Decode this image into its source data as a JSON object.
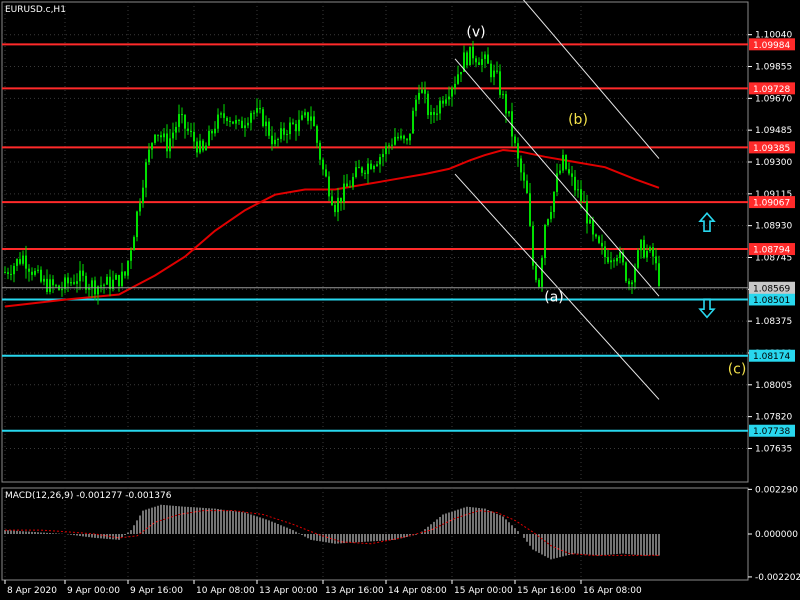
{
  "header": {
    "symbol": "EURUSD.c,H1",
    "macd_label": "MACD(12,26,9) -0.001277 -0.001376"
  },
  "colors": {
    "background": "#000000",
    "grid": "#3a3a3a",
    "candle": "#00e000",
    "ma": "#e00000",
    "resistance": "#ff2a2a",
    "support": "#28d7ee",
    "channel": "#e8e8e8",
    "macd_hist": "#e8e8e8",
    "macd_signal": "#e00000",
    "wave_white": "#ffffff",
    "wave_yellow": "#f3e14a",
    "arrow": "#28d7ee"
  },
  "chart_data": [
    {
      "type": "candlestick",
      "symbol": "EURUSD.c",
      "timeframe": "H1",
      "y_ticks": [
        "1.10040",
        "1.09855",
        "1.09670",
        "1.09485",
        "1.09300",
        "1.09115",
        "1.08930",
        "1.08745",
        "1.08560",
        "1.08375",
        "1.08190",
        "1.08005",
        "1.07820",
        "1.07635"
      ],
      "ylim": [
        1.0744,
        1.1023
      ],
      "x_ticks": [
        "8 Apr 2020",
        "9 Apr 00:00",
        "9 Apr 16:00",
        "10 Apr 08:00",
        "13 Apr 00:00",
        "13 Apr 16:00",
        "14 Apr 08:00",
        "15 Apr 00:00",
        "15 Apr 16:00",
        "16 Apr 08:00"
      ],
      "price_path": [
        [
          0,
          1.0866
        ],
        [
          6,
          1.0875
        ],
        [
          12,
          1.086
        ],
        [
          18,
          1.0856
        ],
        [
          24,
          1.0863
        ],
        [
          30,
          1.0858
        ],
        [
          36,
          1.086
        ],
        [
          40,
          1.0864
        ],
        [
          43,
          1.089
        ],
        [
          46,
          1.092
        ],
        [
          50,
          1.095
        ],
        [
          54,
          1.094
        ],
        [
          58,
          1.0955
        ],
        [
          62,
          1.0945
        ],
        [
          66,
          1.0935
        ],
        [
          70,
          1.0952
        ],
        [
          74,
          1.0958
        ],
        [
          78,
          1.095
        ],
        [
          82,
          1.096
        ],
        [
          86,
          1.0955
        ],
        [
          90,
          1.094
        ],
        [
          94,
          1.095
        ],
        [
          98,
          1.0952
        ],
        [
          102,
          1.0958
        ],
        [
          106,
          1.0925
        ],
        [
          110,
          1.0905
        ],
        [
          114,
          1.0915
        ],
        [
          118,
          1.0925
        ],
        [
          122,
          1.093
        ],
        [
          126,
          1.0935
        ],
        [
          130,
          1.0945
        ],
        [
          134,
          1.094
        ],
        [
          138,
          1.0975
        ],
        [
          142,
          1.0955
        ],
        [
          146,
          1.0968
        ],
        [
          150,
          1.0978
        ],
        [
          153,
          1.099
        ],
        [
          156,
          1.0993
        ],
        [
          160,
          1.0988
        ],
        [
          164,
          1.0978
        ],
        [
          168,
          1.0955
        ],
        [
          171,
          1.093
        ],
        [
          174,
          1.091
        ],
        [
          176,
          1.087
        ],
        [
          178,
          1.086
        ],
        [
          180,
          1.0895
        ],
        [
          182,
          1.0905
        ],
        [
          184,
          1.092
        ],
        [
          186,
          1.093
        ],
        [
          188,
          1.0922
        ],
        [
          190,
          1.0915
        ],
        [
          193,
          1.0905
        ],
        [
          196,
          1.0885
        ],
        [
          200,
          1.0875
        ],
        [
          204,
          1.0878
        ],
        [
          208,
          1.086
        ],
        [
          212,
          1.088
        ],
        [
          216,
          1.0875
        ],
        [
          218,
          1.0862
        ]
      ],
      "ma": [
        [
          0,
          1.0846
        ],
        [
          20,
          1.085
        ],
        [
          38,
          1.0853
        ],
        [
          50,
          1.0864
        ],
        [
          60,
          1.0875
        ],
        [
          70,
          1.089
        ],
        [
          80,
          1.0902
        ],
        [
          90,
          1.0911
        ],
        [
          100,
          1.0914
        ],
        [
          110,
          1.0914
        ],
        [
          120,
          1.0917
        ],
        [
          130,
          1.092
        ],
        [
          140,
          1.0923
        ],
        [
          148,
          1.0926
        ],
        [
          155,
          1.0931
        ],
        [
          160,
          1.0934
        ],
        [
          166,
          1.0937
        ],
        [
          172,
          1.0936
        ],
        [
          180,
          1.0933
        ],
        [
          190,
          1.093
        ],
        [
          200,
          1.0927
        ],
        [
          210,
          1.092
        ],
        [
          218,
          1.0915
        ]
      ],
      "levels": [
        {
          "label": "1.09984",
          "price": 1.09984,
          "kind": "resistance"
        },
        {
          "label": "1.09728",
          "price": 1.09728,
          "kind": "resistance"
        },
        {
          "label": "1.09385",
          "price": 1.09385,
          "kind": "resistance"
        },
        {
          "label": "1.09067",
          "price": 1.09067,
          "kind": "resistance"
        },
        {
          "label": "1.08794",
          "price": 1.08794,
          "kind": "resistance"
        },
        {
          "label": "1.08501",
          "price": 1.08501,
          "kind": "support"
        },
        {
          "label": "1.08174",
          "price": 1.08174,
          "kind": "support"
        },
        {
          "label": "1.07738",
          "price": 1.07738,
          "kind": "support"
        }
      ],
      "current_price": {
        "label": "1.08569",
        "price": 1.08569
      },
      "channel": [
        {
          "from": [
            150,
            1.099
          ],
          "to": [
            218,
            1.0852
          ]
        },
        {
          "from": [
            150,
            1.0923
          ],
          "to": [
            218,
            1.0792
          ]
        },
        {
          "from": [
            170,
            1.103
          ],
          "to": [
            218,
            1.0932
          ]
        }
      ],
      "wave_labels": [
        {
          "text": "(v)",
          "at": [
            157,
            1.1003
          ],
          "color": "wave_white"
        },
        {
          "text": "(b)",
          "at": [
            191,
            1.0952
          ],
          "color": "wave_yellow"
        },
        {
          "text": "(a)",
          "at": [
            183,
            1.0849
          ],
          "color": "wave_white"
        },
        {
          "text": "(c)",
          "at": [
            244,
            1.0807
          ],
          "color": "wave_yellow"
        }
      ],
      "arrows": [
        {
          "direction": "up",
          "at": [
            234,
            1.0895
          ]
        },
        {
          "direction": "down",
          "at": [
            234,
            1.0845
          ]
        }
      ],
      "bars_visible": 219
    },
    {
      "type": "macd",
      "title": "MACD(12,26,9) -0.001277 -0.001376",
      "params": [
        12,
        26,
        9
      ],
      "y_ticks": [
        "0.002290",
        "0.000000",
        "-0.002202"
      ],
      "ylim": [
        -0.00236,
        0.00236
      ],
      "histogram": [
        [
          0,
          0.0002
        ],
        [
          10,
          0.0001
        ],
        [
          20,
          0.0
        ],
        [
          30,
          -0.0002
        ],
        [
          38,
          -0.0003
        ],
        [
          42,
          0.0002
        ],
        [
          46,
          0.0012
        ],
        [
          52,
          0.0015
        ],
        [
          60,
          0.0014
        ],
        [
          70,
          0.0013
        ],
        [
          80,
          0.0011
        ],
        [
          88,
          0.0007
        ],
        [
          96,
          0.0002
        ],
        [
          102,
          -0.0003
        ],
        [
          110,
          -0.0005
        ],
        [
          120,
          -0.0004
        ],
        [
          130,
          -0.0003
        ],
        [
          138,
          0.0
        ],
        [
          146,
          0.001
        ],
        [
          154,
          0.0014
        ],
        [
          160,
          0.0013
        ],
        [
          166,
          0.0009
        ],
        [
          172,
          0.0
        ],
        [
          176,
          -0.0008
        ],
        [
          182,
          -0.0013
        ],
        [
          190,
          -0.001
        ],
        [
          198,
          -0.0011
        ],
        [
          206,
          -0.001
        ],
        [
          212,
          -0.0011
        ],
        [
          218,
          -0.0011
        ]
      ],
      "signal": [
        [
          0,
          0.0002
        ],
        [
          12,
          0.0002
        ],
        [
          22,
          0.0001
        ],
        [
          30,
          0.0
        ],
        [
          38,
          -0.0002
        ],
        [
          44,
          -0.0001
        ],
        [
          50,
          0.0006
        ],
        [
          58,
          0.001
        ],
        [
          66,
          0.0012
        ],
        [
          76,
          0.0012
        ],
        [
          86,
          0.001
        ],
        [
          96,
          0.0005
        ],
        [
          104,
          0.0
        ],
        [
          112,
          -0.0004
        ],
        [
          122,
          -0.0005
        ],
        [
          132,
          -0.0002
        ],
        [
          142,
          0.0002
        ],
        [
          150,
          0.0008
        ],
        [
          158,
          0.0012
        ],
        [
          164,
          0.0011
        ],
        [
          170,
          0.0007
        ],
        [
          176,
          0.0001
        ],
        [
          182,
          -0.0006
        ],
        [
          188,
          -0.001
        ],
        [
          196,
          -0.0011
        ],
        [
          206,
          -0.0011
        ],
        [
          218,
          -0.0011
        ]
      ]
    }
  ]
}
